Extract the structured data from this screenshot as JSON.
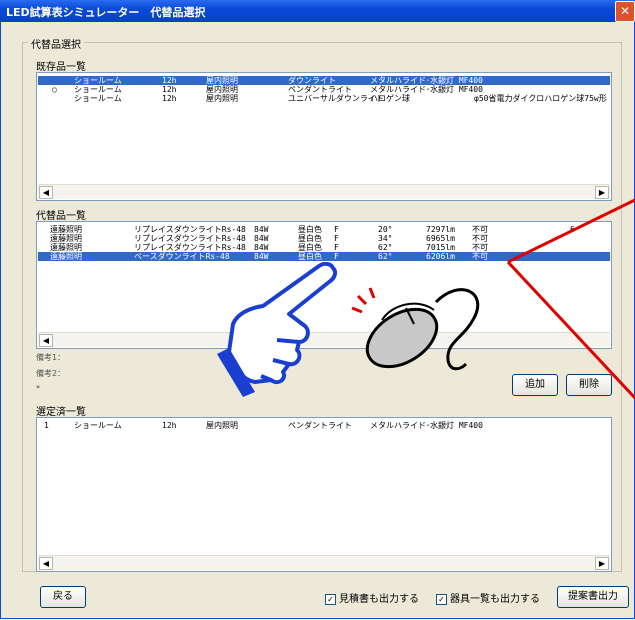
{
  "window": {
    "title": "LED試算表シミュレーター　代替品選択",
    "close": "✕"
  },
  "group_title": "代替品選択",
  "existing": {
    "label": "既存品一覧",
    "rows": [
      {
        "marker": "",
        "c1": "ショールーム",
        "c2": "12h",
        "c3": "屋内照明",
        "c4": "ダウンライト",
        "c5": "メタルハライド･水銀灯 MF400",
        "c6": ""
      },
      {
        "marker": "○",
        "c1": "ショールーム",
        "c2": "12h",
        "c3": "屋内照明",
        "c4": "ペンダントライト",
        "c5": "メタルハライド･水銀灯 MF400",
        "c6": ""
      },
      {
        "marker": "",
        "c1": "ショールーム",
        "c2": "12h",
        "c3": "屋内照明",
        "c4": "ユニバーサルダウンライト",
        "c5": "ハロゲン球",
        "c6": "φ50省電力ダイクロハロゲン球75w形"
      }
    ]
  },
  "alternatives": {
    "label": "代替品一覧",
    "rows": [
      {
        "c1": "遠藤照明",
        "c2": "リプレイスダウンライトRs-48",
        "c3": "84W",
        "c4": "昼白色",
        "c5": "F",
        "c6": "20°",
        "c7": "7297lm",
        "c8": "不可",
        "c9": "6"
      },
      {
        "c1": "遠藤照明",
        "c2": "リプレイスダウンライトRs-48",
        "c3": "84W",
        "c4": "昼白色",
        "c5": "F",
        "c6": "34°",
        "c7": "6965lm",
        "c8": "不可",
        "c9": ""
      },
      {
        "c1": "遠藤照明",
        "c2": "リプレイスダウンライトRs-48",
        "c3": "84W",
        "c4": "昼白色",
        "c5": "F",
        "c6": "62°",
        "c7": "7015lm",
        "c8": "不可",
        "c9": ""
      },
      {
        "c1": "遠藤照明",
        "c2": "ベースダウンライトRs-48",
        "c3": "84W",
        "c4": "昼白色",
        "c5": "F",
        "c6": "62°",
        "c7": "6206lm",
        "c8": "不可",
        "c9": ""
      }
    ]
  },
  "notes": {
    "note1": "備考1：",
    "note2": "備考2：",
    "star": "*"
  },
  "buttons": {
    "add": "追加",
    "delete": "削除",
    "back": "戻る",
    "proposal": "提案書出力"
  },
  "selected": {
    "label": "選定済一覧",
    "rows": [
      {
        "c0": "1",
        "c1": "ショールーム",
        "c2": "12h",
        "c3": "屋内照明",
        "c4": "ペンダントライト",
        "c5": "メタルハライド･水銀灯 MF400"
      }
    ]
  },
  "checkboxes": {
    "estimate": {
      "label": "見積書も出力する",
      "mark": "✓"
    },
    "fixtures": {
      "label": "器具一覧も出力する",
      "mark": "✓"
    }
  },
  "colors": {
    "selection": "#316ac5",
    "callout": "#e00000",
    "hand": "#1a3fd0"
  }
}
